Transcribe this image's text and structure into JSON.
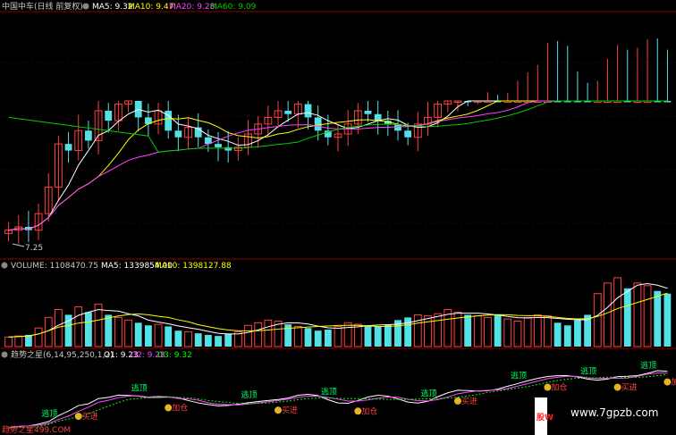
{
  "colors": {
    "bg": "#000000",
    "frame": "#8b0000",
    "up": "#ff4040",
    "down": "#54e1e6",
    "ma5": "#ffffff",
    "ma10": "#ffff00",
    "ma20": "#ff44ff",
    "ma60": "#00cc00",
    "text": "#c8c8c8",
    "vol_ma5": "#ffffff",
    "vol_ma10": "#ffff00",
    "o1": "#ffffff",
    "o2": "#ff44ff",
    "o3": "#00ff00",
    "tag_green": "#00ff66",
    "tag_red": "#ff4040",
    "coin": "#e6b422"
  },
  "header": {
    "title": "中国中车(日线 前复权)",
    "ma5": "MA5: 9.32",
    "ma10": "MA10: 9.47",
    "ma20": "MA20: 9.28",
    "ma60": "MA60: 9.09"
  },
  "price_panel": {
    "low_label": "7.25"
  },
  "volume_panel": {
    "volume": "VOLUME: 1108470.75",
    "ma5": "MA5: 1339854.00",
    "ma10": "MA10: 1398127.88"
  },
  "indicator_panel": {
    "name": "趋势之星(6,14,95,250,1,2)",
    "o1": "O1: 9.23",
    "o2": "O2: 9.28",
    "o3": "O3: 9.32",
    "tag_escape": "逃顶",
    "tag_buy": "买进",
    "tag_add": "加仓"
  },
  "watermark": {
    "url": "www.7gpzb.com",
    "side_text": "股W",
    "bottom_left": "趋势之星499.COM"
  },
  "chart_data": {
    "type": "candlestick",
    "ylim": [
      7,
      10.5
    ],
    "low_marker": 7.25,
    "closes": [
      7.3,
      7.35,
      7.3,
      7.55,
      7.95,
      8.6,
      8.5,
      8.8,
      8.65,
      9.1,
      8.95,
      9.2,
      9.35,
      9.0,
      8.9,
      9.1,
      8.8,
      8.7,
      8.85,
      8.7,
      8.6,
      8.55,
      8.5,
      8.55,
      8.75,
      8.9,
      9.0,
      9.1,
      9.05,
      9.2,
      9.0,
      8.8,
      8.7,
      8.75,
      8.9,
      9.1,
      9.05,
      8.95,
      8.9,
      8.8,
      8.7,
      8.9,
      9.0,
      9.2,
      9.3,
      9.4,
      9.35,
      9.5,
      9.6,
      9.55,
      9.7,
      9.8,
      10.0,
      10.3,
      10.4,
      10.3,
      10.2,
      9.9,
      9.7,
      10.0,
      10.3,
      10.4,
      10.2,
      10.3,
      10.5,
      10.4,
      10.2
    ],
    "volumes": [
      18,
      20,
      22,
      35,
      55,
      70,
      60,
      75,
      65,
      80,
      60,
      55,
      50,
      45,
      40,
      42,
      38,
      30,
      28,
      25,
      22,
      20,
      24,
      28,
      40,
      45,
      50,
      48,
      42,
      38,
      35,
      30,
      32,
      38,
      45,
      42,
      40,
      38,
      42,
      50,
      55,
      60,
      58,
      62,
      70,
      65,
      60,
      58,
      55,
      60,
      52,
      48,
      55,
      60,
      58,
      45,
      40,
      50,
      60,
      100,
      120,
      130,
      110,
      120,
      115,
      105,
      100
    ]
  }
}
